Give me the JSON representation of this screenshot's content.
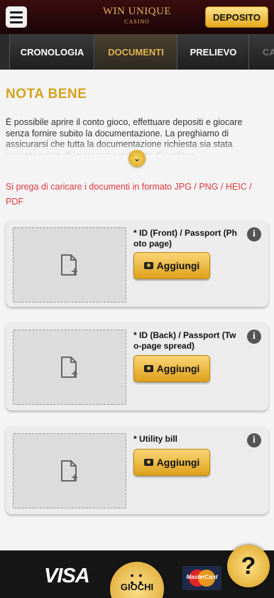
{
  "header": {
    "logo_main": "WIN UNIQUE",
    "logo_sub": "CASINO",
    "deposit_label": "DEPOSITO"
  },
  "tabs": [
    {
      "label": "CRONOLOGIA",
      "active": false
    },
    {
      "label": "DOCUMENTI",
      "active": true
    },
    {
      "label": "PRELIEVO",
      "active": false
    },
    {
      "label": "CA",
      "active": false
    }
  ],
  "nota": {
    "title": "NOTA BENE",
    "text": "È possibile aprire il conto gioco, effettuare depositi e giocare senza fornire subito la documentazione. La preghiamo di assicurarsi che tutta la documentazione richiesta sia stata caricata prima di inviare una richiesta di prelievo."
  },
  "format_note": "Si prega di caricare i documenti in formato JPG / PNG / HEIC / PDF",
  "documents": [
    {
      "title": "* ID (Front) / Passport (Photo page)",
      "button": "Aggiungi"
    },
    {
      "title": "* ID (Back) / Passport (Two-page spread)",
      "button": "Aggiungi"
    },
    {
      "title": "* Utility bill",
      "button": "Aggiungi"
    }
  ],
  "footer": {
    "visa": "VISA",
    "giochi_label": "GIOCHI",
    "mastercard": "MasterCard",
    "help": "?"
  },
  "colors": {
    "accent_gold": "#d4a21e",
    "header_bg": "#3a0d10",
    "warning_red": "#e0393e"
  }
}
